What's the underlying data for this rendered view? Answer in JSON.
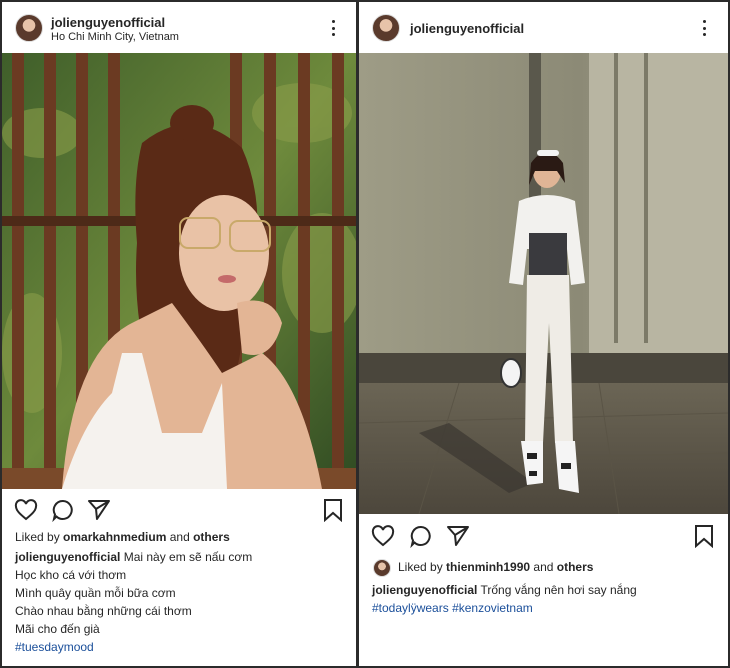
{
  "post1": {
    "username": "jolienguyenofficial",
    "location": "Ho Chi Minh City, Vietnam",
    "liked_prefix": "Liked by ",
    "liked_user": "omarkahnmedium",
    "liked_mid": " and ",
    "liked_others": "others",
    "caption_user": "jolienguyenofficial",
    "caption_lines": [
      "Mai này em sẽ nấu cơm",
      "Học kho cá với thơm",
      "Mình quây quần mỗi bữa cơm",
      "Chào nhau bằng những cái thơm",
      "Mãi cho đến già"
    ],
    "hashtags": [
      "#tuesdaymood"
    ],
    "icons": [
      "heart-icon",
      "comment-icon",
      "share-icon",
      "bookmark-icon",
      "more-options-icon"
    ]
  },
  "post2": {
    "username": "jolienguyenofficial",
    "liked_prefix": "Liked by ",
    "liked_user": "thienminh1990",
    "liked_mid": " and ",
    "liked_others": "others",
    "caption_user": "jolienguyenofficial",
    "caption_text": "Trống vắng nên hơi say nắng",
    "hashtags": [
      "#todaylÿwears",
      "#kenzovietnam"
    ],
    "icons": [
      "heart-icon",
      "comment-icon",
      "share-icon",
      "bookmark-icon",
      "more-options-icon"
    ]
  },
  "colors": {
    "hashtag": "#1b4f9a",
    "border": "#2b2b2b"
  }
}
